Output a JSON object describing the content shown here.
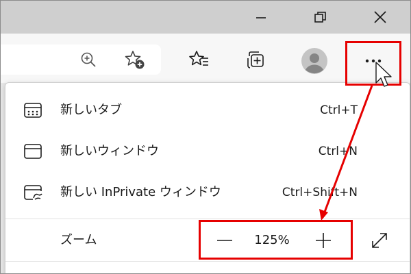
{
  "window_controls": {
    "minimize_icon": "minimize-icon",
    "restore_icon": "restore-icon",
    "close_icon": "close-icon"
  },
  "toolbar": {
    "icons": [
      "zoom-in-icon",
      "add-favorite-icon",
      "favorites-icon",
      "collections-icon",
      "profile-avatar-icon",
      "more-options-icon"
    ]
  },
  "menu": {
    "items": [
      {
        "label": "新しいタブ",
        "shortcut": "Ctrl+T",
        "icon": "new-tab-icon"
      },
      {
        "label": "新しいウィンドウ",
        "shortcut": "Ctrl+N",
        "icon": "new-window-icon"
      },
      {
        "label": "新しい InPrivate ウィンドウ",
        "shortcut": "Ctrl+Shift+N",
        "icon": "inprivate-window-icon"
      }
    ],
    "zoom": {
      "label": "ズーム",
      "decrease": "—",
      "value": "125%",
      "increase": "+",
      "fullscreen_icon": "fullscreen-icon"
    }
  },
  "annotation": {
    "color": "#e60000"
  },
  "colors": {
    "titlebar": "#cfcfcf",
    "toolbar": "#f7f7f7",
    "menu": "#ffffff"
  }
}
